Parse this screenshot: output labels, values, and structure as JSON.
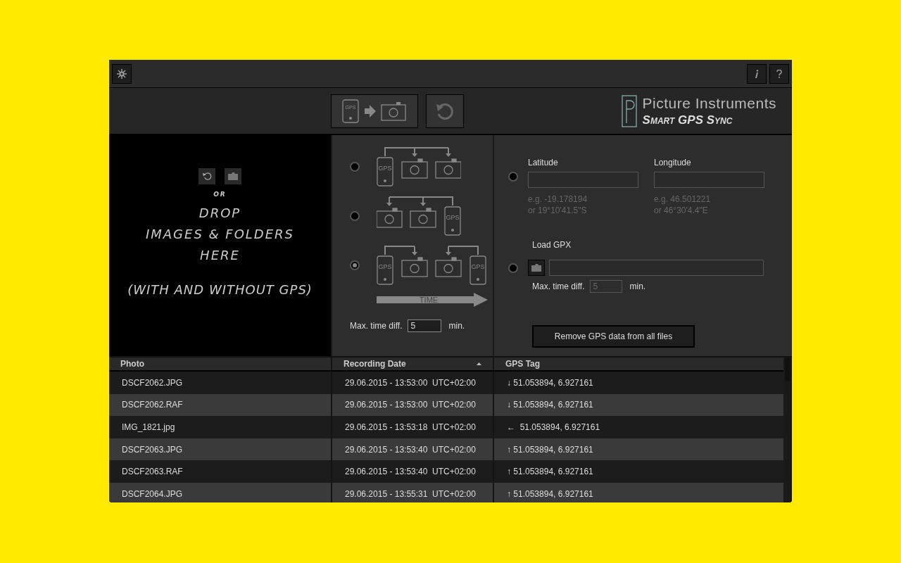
{
  "header": {
    "sync_button": {
      "label": "GPS"
    },
    "logo": {
      "title": "Picture Instruments",
      "subtitle": "Smart GPS Sync"
    }
  },
  "drop_zone": {
    "or": "OR",
    "lines": [
      "DROP",
      "IMAGES & FOLDERS",
      "HERE"
    ],
    "note": "(WITH AND WITHOUT GPS)"
  },
  "modes": {
    "options": [
      {
        "selected": false,
        "devices": [
          {
            "kind": "gps",
            "label": "GPS"
          },
          {
            "kind": "camera"
          },
          {
            "kind": "camera"
          }
        ]
      },
      {
        "selected": false,
        "devices": [
          {
            "kind": "camera"
          },
          {
            "kind": "camera"
          },
          {
            "kind": "gps",
            "label": "GPS"
          }
        ]
      },
      {
        "selected": true,
        "devices": [
          {
            "kind": "gps",
            "label": "GPS"
          },
          {
            "kind": "camera"
          },
          {
            "kind": "camera"
          },
          {
            "kind": "gps",
            "label": "GPS"
          }
        ]
      }
    ],
    "time_axis": "TIME",
    "max_time_label": "Max. time diff.",
    "max_time_value": "5",
    "unit": "min."
  },
  "location": {
    "manual": {
      "selected": false,
      "latitude": {
        "label": "Latitude",
        "hint": [
          "e.g. -19.178194",
          "or 19°10'41.5\"S"
        ]
      },
      "longitude": {
        "label": "Longitude",
        "hint": [
          "e.g. 46.501221",
          "or 46°30'4.4\"E"
        ]
      }
    },
    "gpx": {
      "selected": false,
      "label": "Load GPX",
      "max_time_label": "Max. time diff.",
      "max_time_value": "5",
      "max_time_disabled": true,
      "unit": "min."
    },
    "remove_button": "Remove GPS data from all files"
  },
  "table": {
    "columns": [
      {
        "label": "Photo",
        "sorted": false
      },
      {
        "label": "Recording Date",
        "sorted": true
      },
      {
        "label": "GPS Tag",
        "sorted": false
      }
    ],
    "rows": [
      [
        "DSCF2062.JPG",
        "29.06.2015 - 13:53:00  UTC+02:00",
        "↓ 51.053894, 6.927161"
      ],
      [
        "DSCF2062.RAF",
        "29.06.2015 - 13:53:00  UTC+02:00",
        "↓ 51.053894, 6.927161"
      ],
      [
        "IMG_1821.jpg",
        "29.06.2015 - 13:53:18  UTC+02:00",
        "←  51.053894, 6.927161"
      ],
      [
        "DSCF2063.JPG",
        "29.06.2015 - 13:53:40  UTC+02:00",
        "↑ 51.053894, 6.927161"
      ],
      [
        "DSCF2063.RAF",
        "29.06.2015 - 13:53:40  UTC+02:00",
        "↑ 51.053894, 6.927161"
      ],
      [
        "DSCF2064.JPG",
        "29.06.2015 - 13:55:31  UTC+02:00",
        "↑ 51.053894, 6.927161"
      ]
    ]
  }
}
